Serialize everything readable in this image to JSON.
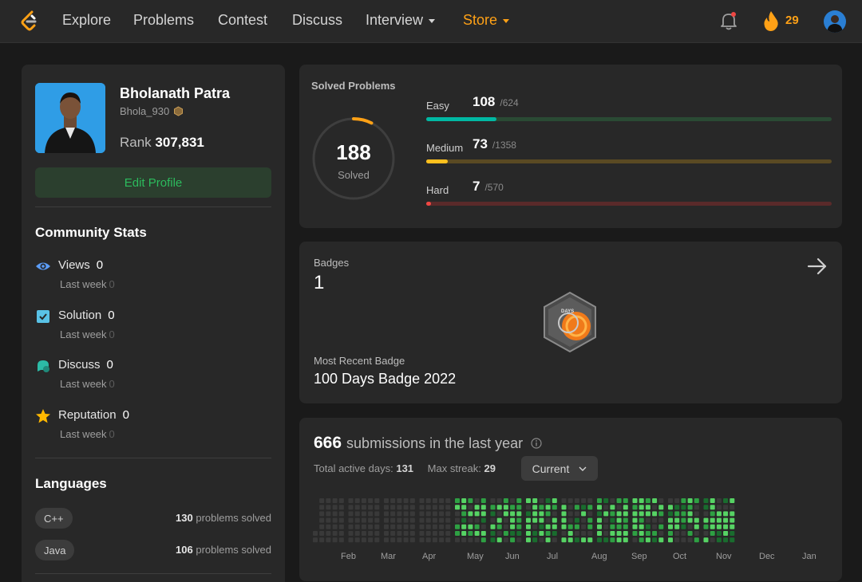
{
  "nav": {
    "items": [
      "Explore",
      "Problems",
      "Contest",
      "Discuss",
      "Interview",
      "Store"
    ],
    "streak": "29",
    "accent": "#ffa116"
  },
  "profile": {
    "name": "Bholanath Patra",
    "username": "Bhola_930",
    "rank_label": "Rank",
    "rank_value": "307,831",
    "edit_label": "Edit Profile"
  },
  "community": {
    "title": "Community Stats",
    "stats": [
      {
        "label": "Views",
        "value": "0",
        "sub": "Last week",
        "sub_value": "0",
        "icon": "eye-icon",
        "color": "#5b9cf6"
      },
      {
        "label": "Solution",
        "value": "0",
        "sub": "Last week",
        "sub_value": "0",
        "icon": "checkbox-icon",
        "color": "#59c2e6"
      },
      {
        "label": "Discuss",
        "value": "0",
        "sub": "Last week",
        "sub_value": "0",
        "icon": "chat-icon",
        "color": "#2cbba6"
      },
      {
        "label": "Reputation",
        "value": "0",
        "sub": "Last week",
        "sub_value": "0",
        "icon": "star-icon",
        "color": "#ffb800"
      }
    ]
  },
  "languages": {
    "title": "Languages",
    "items": [
      {
        "name": "C++",
        "count": "130",
        "suffix": "problems solved"
      },
      {
        "name": "Java",
        "count": "106",
        "suffix": "problems solved"
      }
    ]
  },
  "solved": {
    "title": "Solved Problems",
    "total": "188",
    "total_label": "Solved",
    "total_fraction": 0.074,
    "difficulties": [
      {
        "label": "Easy",
        "solved": "108",
        "total": "/624",
        "fraction": 0.173,
        "color": "#00b8a3",
        "track": "#2a4a34"
      },
      {
        "label": "Medium",
        "solved": "73",
        "total": "/1358",
        "fraction": 0.054,
        "color": "#ffc01e",
        "track": "#5a4a23"
      },
      {
        "label": "Hard",
        "solved": "7",
        "total": "/570",
        "fraction": 0.012,
        "color": "#ef4743",
        "track": "#5a2a2a"
      }
    ]
  },
  "badges": {
    "title": "Badges",
    "count": "1",
    "recent_label": "Most Recent Badge",
    "recent_name": "100 Days Badge 2022",
    "badge_text": "DAYS"
  },
  "submissions": {
    "count": "666",
    "label": "submissions in the last year",
    "active_label": "Total active days:",
    "active_value": "131",
    "streak_label": "Max streak:",
    "streak_value": "29",
    "range": "Current",
    "months": [
      "Feb",
      "Mar",
      "Apr",
      "May",
      "Jun",
      "Jul",
      "Aug",
      "Sep",
      "Oct",
      "Nov",
      "Dec",
      "Jan"
    ],
    "colors": {
      "empty": "#393939",
      "l1": "#0e4429",
      "l2": "#196c2e",
      "l3": "#2ea043",
      "l4": "#56d364"
    }
  }
}
